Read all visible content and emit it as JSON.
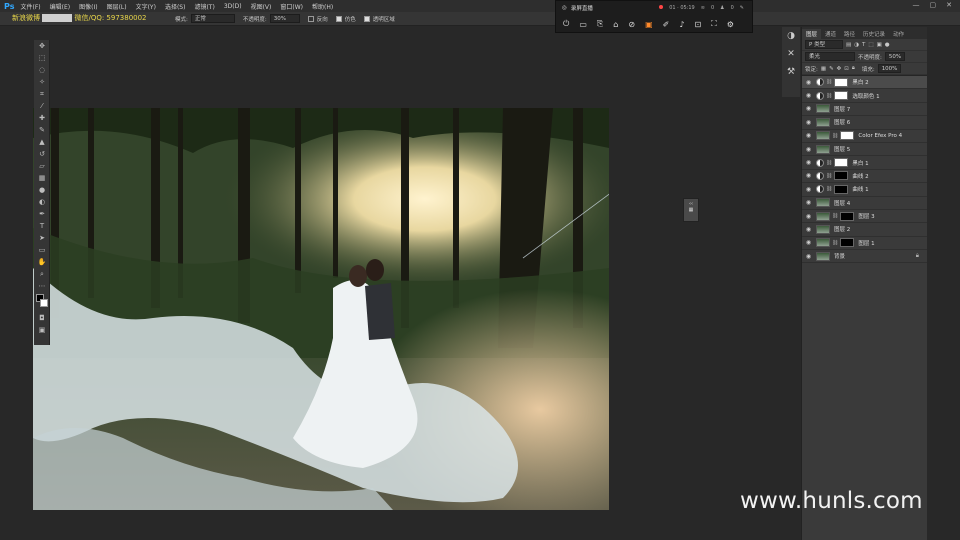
{
  "menubar": {
    "logo": "Ps",
    "items": [
      "文件(F)",
      "编辑(E)",
      "图像(I)",
      "图层(L)",
      "文字(Y)",
      "选择(S)",
      "滤镜(T)",
      "3D(D)",
      "视图(V)",
      "窗口(W)",
      "帮助(H)"
    ]
  },
  "options_bar": {
    "mode_label": "模式:",
    "mode_value": "正常",
    "opacity_label": "不透明度:",
    "opacity_value": "30%",
    "reverse_label": "反向",
    "dither_label": "仿色",
    "transparency_label": "透明区域"
  },
  "watermark_top": {
    "text_a": "新浪微博",
    "text_b": "微信/QQ: 597380002"
  },
  "toolbar": {
    "tools": [
      "move-tool",
      "marquee-tool",
      "lasso-tool",
      "magic-wand-tool",
      "crop-tool",
      "eyedropper-tool",
      "healing-tool",
      "brush-tool",
      "clone-stamp-tool",
      "history-brush-tool",
      "eraser-tool",
      "gradient-tool",
      "blur-tool",
      "dodge-tool",
      "pen-tool",
      "type-tool",
      "path-selection-tool",
      "shape-tool",
      "hand-tool",
      "zoom-tool"
    ]
  },
  "floater": {
    "title": "录屏直播",
    "stat_time": "01 · 05:19",
    "stat_signal": "0",
    "stat_users": "0"
  },
  "panel": {
    "tabs": [
      "图层",
      "通道",
      "路径",
      "历史记录",
      "动作"
    ],
    "kind_label": "P 类型",
    "blend_mode": "柔光",
    "opacity_label": "不透明度:",
    "opacity_value": "50%",
    "lock_label": "锁定:",
    "fill_label": "填充:",
    "fill_value": "100%",
    "layers": [
      {
        "name": "黑白 2",
        "type": "adjustment",
        "mask": "white",
        "selected": true
      },
      {
        "name": "选取颜色 1",
        "type": "adjustment",
        "mask": "white",
        "selected": false
      },
      {
        "name": "图层 7",
        "type": "photo",
        "mask": "",
        "selected": false
      },
      {
        "name": "图层 6",
        "type": "photo",
        "mask": "",
        "selected": false
      },
      {
        "name": "Color Efex Pro 4",
        "type": "photo",
        "mask": "white",
        "selected": false
      },
      {
        "name": "图层 5",
        "type": "photo",
        "mask": "",
        "selected": false
      },
      {
        "name": "黑白 1",
        "type": "adjustment",
        "mask": "white",
        "selected": false
      },
      {
        "name": "曲线 2",
        "type": "adjustment",
        "mask": "black",
        "selected": false
      },
      {
        "name": "曲线 1",
        "type": "adjustment",
        "mask": "black",
        "selected": false
      },
      {
        "name": "图层 4",
        "type": "photo",
        "mask": "",
        "selected": false
      },
      {
        "name": "图层 3",
        "type": "photo",
        "mask": "black",
        "selected": false
      },
      {
        "name": "图层 2",
        "type": "photo",
        "mask": "",
        "selected": false
      },
      {
        "name": "图层 1",
        "type": "photo",
        "mask": "black",
        "selected": false
      },
      {
        "name": "背景",
        "type": "photo",
        "mask": "",
        "selected": false,
        "locked": true
      }
    ]
  },
  "watermark_br": "www.hunls.com"
}
